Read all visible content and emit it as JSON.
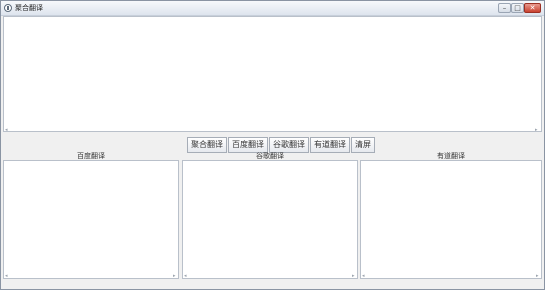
{
  "window": {
    "title": "聚合翻译"
  },
  "toolbar": {
    "buttons": [
      "聚合翻译",
      "百度翻译",
      "谷歌翻译",
      "有道翻译",
      "清屏"
    ]
  },
  "panels": {
    "baidu_label": "百度翻译",
    "google_label": "谷歌翻译",
    "youdao_label": "有道翻译"
  },
  "colors": {
    "background": "#f0f0f0",
    "text_area": "#ffffff",
    "close_button": "#c9412f"
  }
}
